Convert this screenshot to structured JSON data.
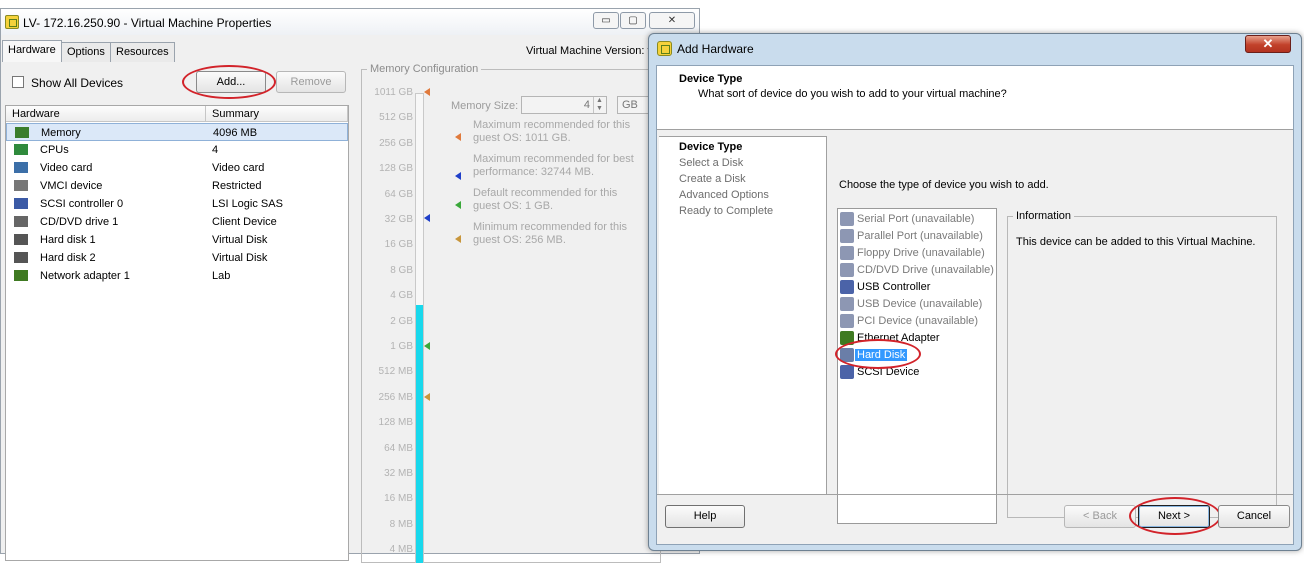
{
  "vm_window": {
    "title": "LV- 172.16.250.90 - Virtual Machine Properties",
    "minimize": "▭",
    "maximize": "▢",
    "close": "✕",
    "tabs": [
      "Hardware",
      "Options",
      "Resources"
    ],
    "version": "Virtual Machine Version: v",
    "show_all_devices": "Show All Devices",
    "add_button": "Add...",
    "remove_button": "Remove",
    "table": {
      "col_hardware": "Hardware",
      "col_summary": "Summary",
      "rows": [
        {
          "name": "Memory",
          "summary": "4096 MB",
          "icon": "memory-icon",
          "color": "#3a7d2c"
        },
        {
          "name": "CPUs",
          "summary": "4",
          "icon": "cpu-icon",
          "color": "#2f8a3c"
        },
        {
          "name": "Video card",
          "summary": "Video card",
          "icon": "monitor-icon",
          "color": "#3c6fa8"
        },
        {
          "name": "VMCI device",
          "summary": "Restricted",
          "icon": "device-icon",
          "color": "#777777"
        },
        {
          "name": "SCSI controller 0",
          "summary": "LSI Logic SAS",
          "icon": "scsi-icon",
          "color": "#3b5aa6"
        },
        {
          "name": "CD/DVD drive 1",
          "summary": "Client Device",
          "icon": "cd-icon",
          "color": "#666666"
        },
        {
          "name": "Hard disk 1",
          "summary": "Virtual Disk",
          "icon": "disk-icon",
          "color": "#555555"
        },
        {
          "name": "Hard disk 2",
          "summary": "Virtual Disk",
          "icon": "disk-icon",
          "color": "#555555"
        },
        {
          "name": "Network adapter 1",
          "summary": "Lab",
          "icon": "network-icon",
          "color": "#3f7a22"
        }
      ]
    },
    "memory": {
      "legend": "Memory Configuration",
      "size_label": "Memory Size:",
      "size_value": "4",
      "unit": "GB",
      "scale": [
        "1011 GB",
        "512 GB",
        "256 GB",
        "128 GB",
        "64 GB",
        "32 GB",
        "16 GB",
        "8 GB",
        "4 GB",
        "2 GB",
        "1 GB",
        "512 MB",
        "256 MB",
        "128 MB",
        "64 MB",
        "32 MB",
        "16 MB",
        "8 MB",
        "4 MB"
      ],
      "hints": [
        {
          "text": "Maximum recommended for this guest OS: 1011 GB.",
          "color": "#e07a3c"
        },
        {
          "text": "Maximum recommended for best performance: 32744 MB.",
          "color": "#1f3fc9"
        },
        {
          "text": "Default recommended for this guest OS: 1 GB.",
          "color": "#3aa83a"
        },
        {
          "text": "Minimum recommended for this guest OS: 256 MB.",
          "color": "#c8963c"
        }
      ]
    }
  },
  "dialog": {
    "title": "Add Hardware",
    "close": "✕",
    "header_title": "Device Type",
    "header_subtitle": "What sort of device do you wish to add to your virtual machine?",
    "steps": [
      "Device Type",
      "Select a Disk",
      "Create a Disk",
      "Advanced Options",
      "Ready to Complete"
    ],
    "choose_text": "Choose the type of device you wish to add.",
    "devices": [
      {
        "label": "Serial Port (unavailable)",
        "icon": "serial-port-icon",
        "available": false
      },
      {
        "label": "Parallel Port (unavailable)",
        "icon": "parallel-port-icon",
        "available": false
      },
      {
        "label": "Floppy Drive (unavailable)",
        "icon": "floppy-icon",
        "available": false
      },
      {
        "label": "CD/DVD Drive (unavailable)",
        "icon": "cd-icon",
        "available": false
      },
      {
        "label": "USB Controller",
        "icon": "usb-icon",
        "available": true
      },
      {
        "label": "USB Device (unavailable)",
        "icon": "usb-device-icon",
        "available": false
      },
      {
        "label": "PCI Device (unavailable)",
        "icon": "pci-icon",
        "available": false
      },
      {
        "label": "Ethernet Adapter",
        "icon": "network-icon",
        "available": true
      },
      {
        "label": "Hard Disk",
        "icon": "disk-icon",
        "available": true,
        "selected": true
      },
      {
        "label": "SCSI Device",
        "icon": "scsi-icon",
        "available": true
      }
    ],
    "info_legend": "Information",
    "info_text": "This device can be added to this Virtual Machine.",
    "help": "Help",
    "back": "< Back",
    "next": "Next >",
    "cancel": "Cancel",
    "highlight_color": "#d2232a",
    "selection_color": "#3399ff"
  }
}
